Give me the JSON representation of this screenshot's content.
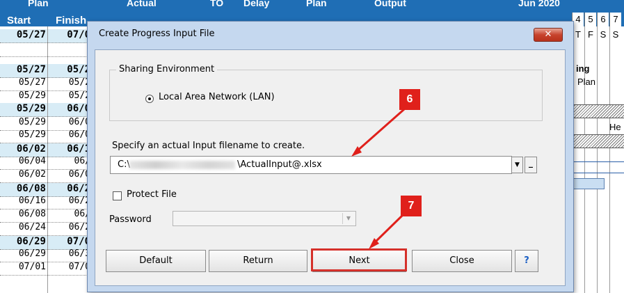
{
  "sheet": {
    "header_top": [
      "Plan",
      "Actual",
      "TO",
      "Delay",
      "Plan",
      "Output",
      "Jun 2020"
    ],
    "header_bottom": [
      "Start",
      "Finish"
    ],
    "calendar_days": [
      "4",
      "5",
      "6",
      "7"
    ],
    "calendar_weekdays": [
      "T",
      "F",
      "S",
      "S"
    ],
    "rows": [
      {
        "start": "05/27",
        "finish": "07/0",
        "summary": true
      },
      {
        "start": "",
        "finish": "",
        "summary": false
      },
      {
        "start": "05/27",
        "finish": "05/2",
        "summary": true
      },
      {
        "start": "05/27",
        "finish": "05/2",
        "summary": false
      },
      {
        "start": "05/29",
        "finish": "05/2",
        "summary": false
      },
      {
        "start": "05/29",
        "finish": "06/0",
        "summary": true
      },
      {
        "start": "05/29",
        "finish": "06/0",
        "summary": false
      },
      {
        "start": "05/29",
        "finish": "06/0",
        "summary": false
      },
      {
        "start": "06/02",
        "finish": "06/1",
        "summary": true
      },
      {
        "start": "06/04",
        "finish": "06/",
        "summary": false
      },
      {
        "start": "06/02",
        "finish": "06/0",
        "summary": false
      },
      {
        "start": "06/08",
        "finish": "06/2",
        "summary": true
      },
      {
        "start": "06/16",
        "finish": "06/2",
        "summary": false
      },
      {
        "start": "06/08",
        "finish": "06/",
        "summary": false
      },
      {
        "start": "06/24",
        "finish": "06/2",
        "summary": false
      },
      {
        "start": "06/29",
        "finish": "07/0",
        "summary": true
      },
      {
        "start": "06/29",
        "finish": "06/3",
        "summary": false
      },
      {
        "start": "07/01",
        "finish": "07/0",
        "summary": false
      }
    ],
    "gantt_text": {
      "ing": "ing",
      "plan": "Plan",
      "he": "He"
    }
  },
  "dialog": {
    "title": "Create Progress Input File",
    "close_glyph": "✕",
    "sharing_legend": "Sharing Environment",
    "radio_label": "Local Area Network (LAN)",
    "radio_selected": true,
    "spec_label": "Specify an actual Input filename to create.",
    "file_prefix": "C:\\",
    "file_suffix": "\\ActualInput@.xlsx",
    "protect_label": "Protect File",
    "protect_checked": false,
    "password_label": "Password",
    "password_value": "",
    "buttons": {
      "default": "Default",
      "return": "Return",
      "next": "Next",
      "close": "Close",
      "help": "?"
    }
  },
  "annotations": {
    "badge_6": "6",
    "badge_7": "7",
    "color": "#e0201b"
  }
}
